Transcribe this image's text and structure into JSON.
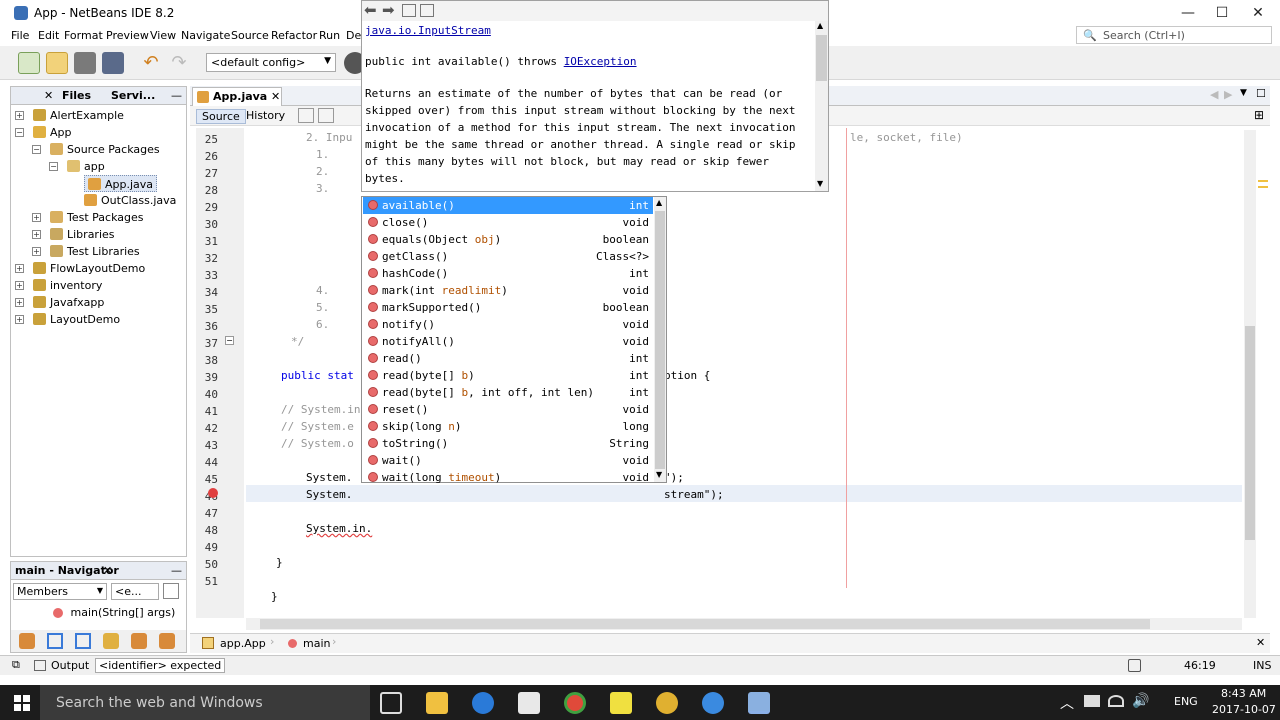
{
  "window": {
    "title": "App - NetBeans IDE 8.2"
  },
  "menu": [
    "File",
    "Edit",
    "Format",
    "Preview",
    "View",
    "Navigate",
    "Source",
    "Refactor",
    "Run",
    "De"
  ],
  "search": {
    "placeholder": "Search (Ctrl+I)"
  },
  "toolbar": {
    "config": "<default config>"
  },
  "panel_tabs": [
    "Files",
    "Servi..."
  ],
  "tree": [
    {
      "label": "AlertExample",
      "depth": 0,
      "expander": "+"
    },
    {
      "label": "App",
      "depth": 0,
      "expander": "−"
    },
    {
      "label": "Source Packages",
      "depth": 1,
      "expander": "−"
    },
    {
      "label": "app",
      "depth": 2,
      "expander": "−"
    },
    {
      "label": "App.java",
      "depth": 3,
      "expander": ""
    },
    {
      "label": "OutClass.java",
      "depth": 3,
      "expander": ""
    },
    {
      "label": "Test Packages",
      "depth": 1,
      "expander": "+"
    },
    {
      "label": "Libraries",
      "depth": 1,
      "expander": "+"
    },
    {
      "label": "Test Libraries",
      "depth": 1,
      "expander": "+"
    },
    {
      "label": "FlowLayoutDemo",
      "depth": 0,
      "expander": "+"
    },
    {
      "label": "inventory",
      "depth": 0,
      "expander": "+"
    },
    {
      "label": "Javafxapp",
      "depth": 0,
      "expander": "+"
    },
    {
      "label": "LayoutDemo",
      "depth": 0,
      "expander": "+"
    }
  ],
  "navigator": {
    "title": "main - Navigator",
    "filter": "Members",
    "filter2": "<e...",
    "item": "main(String[] args)"
  },
  "editor": {
    "tab": "App.java",
    "source_label": "Source",
    "history_label": "History",
    "line_numbers": [
      "25",
      "26",
      "27",
      "28",
      "29",
      "30",
      "31",
      "32",
      "33",
      "34",
      "35",
      "36",
      "37",
      "38",
      "39",
      "40",
      "41",
      "42",
      "43",
      "44",
      "45",
      "46",
      "47",
      "48",
      "49",
      "50",
      "51"
    ],
    "lines": [
      {
        "n": 0,
        "indent": 6,
        "text": "2. Inpu",
        "cls": "comment"
      },
      {
        "n": 1,
        "indent": 8,
        "text": "1.",
        "cls": "comment"
      },
      {
        "n": 2,
        "indent": 8,
        "text": "2.",
        "cls": "comment"
      },
      {
        "n": 3,
        "indent": 8,
        "text": "3.",
        "cls": "comment"
      },
      {
        "n": 9,
        "indent": 8,
        "text": "4.",
        "cls": "comment"
      },
      {
        "n": 10,
        "indent": 8,
        "text": "5.",
        "cls": "comment"
      },
      {
        "n": 11,
        "indent": 8,
        "text": "6.",
        "cls": "comment"
      },
      {
        "n": 12,
        "indent": 3,
        "text": "*/",
        "cls": "comment"
      },
      {
        "n": 14,
        "indent": 1,
        "text": "public stat",
        "cls": "kw"
      },
      {
        "n": 16,
        "indent": 1,
        "text": "// System.in",
        "cls": "comment"
      },
      {
        "n": 17,
        "indent": 1,
        "text": "// System.e",
        "cls": "comment"
      },
      {
        "n": 18,
        "indent": 1,
        "text": "// System.o",
        "cls": "comment"
      },
      {
        "n": 20,
        "indent": 6,
        "text": "System.",
        "cls": ""
      },
      {
        "n": 21,
        "indent": 6,
        "text": "System.",
        "cls": ""
      },
      {
        "n": 23,
        "indent": 6,
        "text": "System.in.",
        "cls": ""
      },
      {
        "n": 25,
        "indent": 0,
        "text": "}",
        "cls": ""
      },
      {
        "n": 27,
        "indent": -1,
        "text": "}",
        "cls": ""
      }
    ],
    "right_fragments": [
      {
        "n": 0,
        "text": "le, socket, file)",
        "cls": "comment"
      },
      {
        "n": 14,
        "text": "ption {",
        "cls": ""
      },
      {
        "n": 20,
        "text": "\");",
        "cls": ""
      },
      {
        "n": 21,
        "text": "stream\");",
        "cls": ""
      }
    ]
  },
  "javadoc": {
    "class": "java.io.InputStream",
    "signature": "public int available() throws ",
    "exception": "IOException",
    "description": "Returns an estimate of the number of bytes that can be read (or skipped over) from this input stream without blocking by the next invocation of a method for this input stream. The next invocation might be the same thread or another thread. A single read or skip of this many bytes will not block, but may read or skip fewer bytes."
  },
  "completion": [
    {
      "name": "available()",
      "params": "",
      "type": "int",
      "selected": true
    },
    {
      "name": "close()",
      "params": "",
      "type": "void"
    },
    {
      "name": "equals(Object ",
      "params": "obj",
      "tail": ")",
      "type": "boolean"
    },
    {
      "name": "getClass()",
      "params": "",
      "type": "Class<?>"
    },
    {
      "name": "hashCode()",
      "params": "",
      "type": "int"
    },
    {
      "name": "mark(int ",
      "params": "readlimit",
      "tail": ")",
      "type": "void"
    },
    {
      "name": "markSupported()",
      "params": "",
      "type": "boolean"
    },
    {
      "name": "notify()",
      "params": "",
      "type": "void"
    },
    {
      "name": "notifyAll()",
      "params": "",
      "type": "void"
    },
    {
      "name": "read()",
      "params": "",
      "type": "int"
    },
    {
      "name": "read(byte[] ",
      "params": "b",
      "tail": ")",
      "type": "int"
    },
    {
      "name": "read(byte[] ",
      "params": "b",
      "tail": ", int off, int len)",
      "type": "int"
    },
    {
      "name": "reset()",
      "params": "",
      "type": "void"
    },
    {
      "name": "skip(long ",
      "params": "n",
      "tail": ")",
      "type": "long"
    },
    {
      "name": "toString()",
      "params": "",
      "type": "String"
    },
    {
      "name": "wait()",
      "params": "",
      "type": "void"
    },
    {
      "name": "wait(long ",
      "params": "timeout",
      "tail": ")",
      "type": "void"
    }
  ],
  "breadcrumbs": [
    "app.App",
    "main"
  ],
  "status": {
    "output": "Output",
    "message": "<identifier> expected",
    "position": "46:19",
    "mode": "INS"
  },
  "taskbar": {
    "search": "Search the web and Windows",
    "lang": "ENG",
    "time": "8:43 AM",
    "date": "2017-10-07"
  }
}
